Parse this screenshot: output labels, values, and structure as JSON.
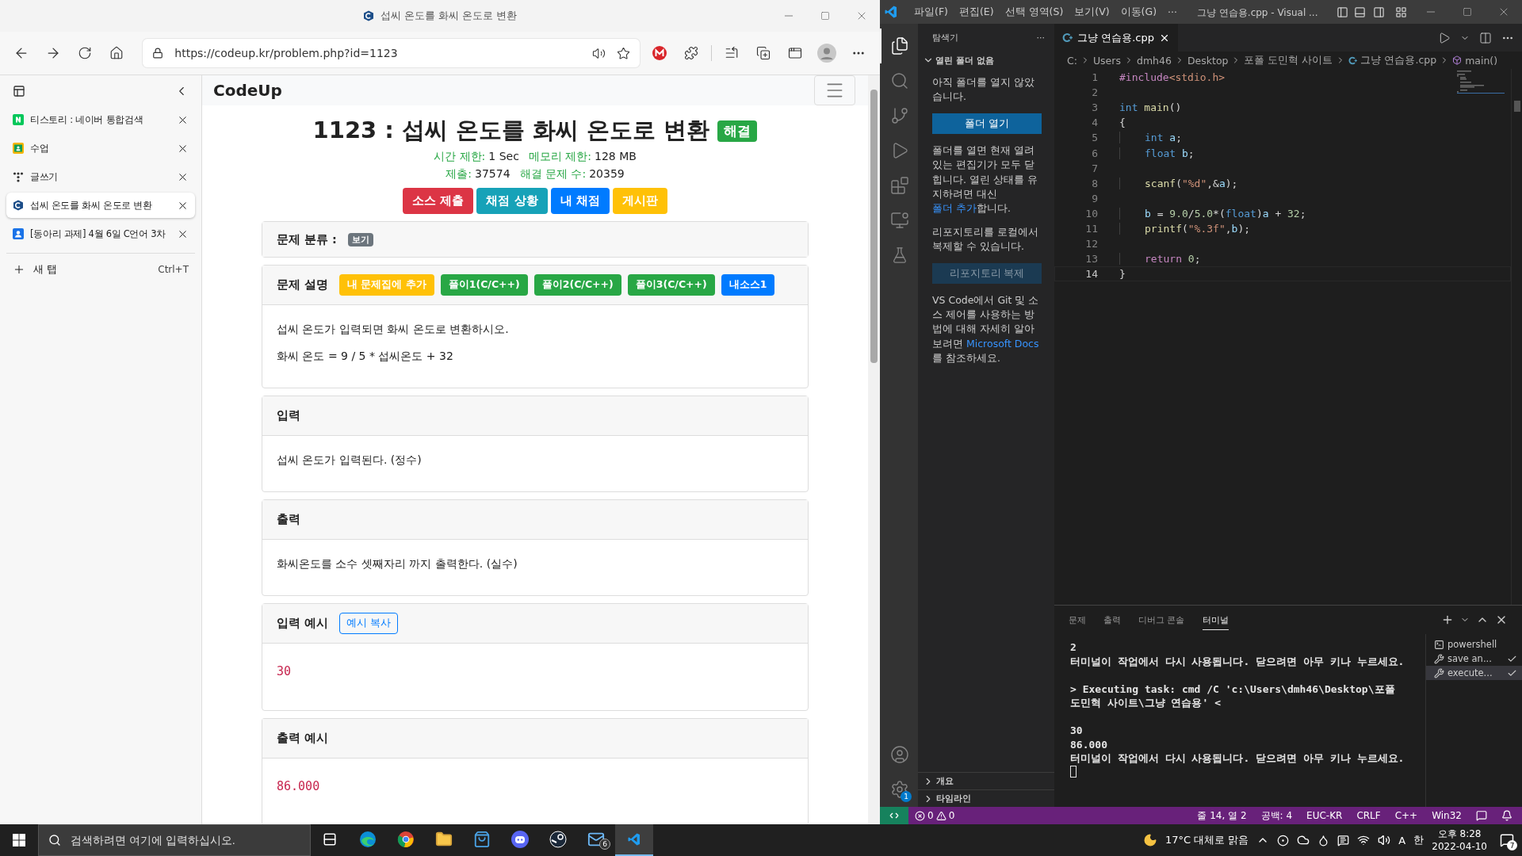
{
  "browser": {
    "title": "섭씨 온도를 화씨 온도로 변환",
    "url": "https://codeup.kr/problem.php?id=1123",
    "tabs": [
      {
        "label": "티스토리 : 네이버 통합검색",
        "selected": false
      },
      {
        "label": "수업",
        "selected": false
      },
      {
        "label": "글쓰기",
        "selected": false
      },
      {
        "label": "섭씨 온도를 화씨 온도로 변환",
        "selected": true
      },
      {
        "label": "[동아리 과제] 4월 6일 C언어 3차",
        "selected": false
      }
    ],
    "new_tab": {
      "label": "새 탭",
      "shortcut": "Ctrl+T"
    }
  },
  "page": {
    "brand": "CodeUp",
    "title": "1123 : 섭씨 온도를 화씨 온도로 변환",
    "solved_badge": "해결",
    "meta": [
      [
        {
          "label": "시간 제한:",
          "value": "1 Sec"
        },
        {
          "label": "메모리 제한:",
          "value": "128 MB"
        }
      ],
      [
        {
          "label": "제출:",
          "value": "37574"
        },
        {
          "label": "해결 문제 수:",
          "value": "20359"
        }
      ]
    ],
    "actions": [
      {
        "label": "소스 제출",
        "color": "#dc3545"
      },
      {
        "label": "채점 상황",
        "color": "#17a2b8"
      },
      {
        "label": "내 채점",
        "color": "#007bff"
      },
      {
        "label": "게시판",
        "color": "#ffc107"
      }
    ],
    "cards": [
      {
        "kind": "category",
        "title": "문제 분류 :",
        "badge": "보기"
      },
      {
        "kind": "text",
        "title": "문제 설명",
        "buttons": [
          {
            "label": "내 문제집에 추가",
            "color": "#ffc107"
          },
          {
            "label": "풀이1(C/C++)",
            "color": "#28a745"
          },
          {
            "label": "풀이2(C/C++)",
            "color": "#28a745"
          },
          {
            "label": "풀이3(C/C++)",
            "color": "#28a745"
          },
          {
            "label": "내소스1",
            "color": "#007bff"
          }
        ],
        "paragraphs": [
          "섭씨 온도가 입력되면 화씨 온도로 변환하시오.",
          "화씨 온도 = 9 / 5 * 섭씨온도 + 32"
        ]
      },
      {
        "kind": "text",
        "title": "입력",
        "paragraphs": [
          "섭씨 온도가 입력된다. (정수)"
        ]
      },
      {
        "kind": "text",
        "title": "출력",
        "paragraphs": [
          "화씨온도를 소수 셋째자리 까지 출력한다. (실수)"
        ]
      },
      {
        "kind": "sample",
        "title": "입력 예시",
        "copy_button": "예시 복사",
        "sample": "30"
      },
      {
        "kind": "sample",
        "title": "출력 예시",
        "sample": "86.000"
      }
    ]
  },
  "vscode": {
    "menu": [
      "파일(F)",
      "편집(E)",
      "선택 영역(S)",
      "보기(V)",
      "이동(G)",
      "···"
    ],
    "title": "그냥 연습용.cpp - Visual ...",
    "explorer": {
      "header": "탐색기",
      "more": "···",
      "section": "열린 폴더 없음",
      "intro": "아직 폴더를 열지 않았습니다.",
      "open_button": "폴더 열기",
      "note": {
        "before": "폴더를 열면 현재 열려 있는 편집기가 모두 닫힙니다. 열린 상태를 유지하려면 대신 ",
        "link": "폴더 추가",
        "after": "합니다."
      },
      "clone_text": "리포지토리를 로컬에서 복제할 수 있습니다.",
      "clone_button": "리포지토리 복제",
      "git_note": {
        "before": "VS Code에서 Git 및 소스 제어를 사용하는 방법에 대해 자세히 알아보려면 ",
        "link": "Microsoft Docs",
        "after": "를 참조하세요."
      },
      "bottom_sections": [
        "개요",
        "타임라인"
      ]
    },
    "settings_badge": "1",
    "tab": {
      "label": "그냥 연습용.cpp"
    },
    "breadcrumb": [
      "C:",
      "Users",
      "dmh46",
      "Desktop",
      "포폴 도민혁 사이트",
      "그냥 연습용.cpp",
      "main()"
    ],
    "code": [
      {
        "number": "1",
        "current": false,
        "indented": false,
        "tokens": [
          {
            "text": "#include",
            "kind": "control"
          },
          {
            "text": "<stdio.h>",
            "kind": "string"
          }
        ]
      },
      {
        "number": "2",
        "current": false
      },
      {
        "number": "3",
        "current": false,
        "indented": false,
        "tokens": [
          {
            "text": "int ",
            "kind": "keyword"
          },
          {
            "text": "main",
            "kind": "function"
          },
          {
            "text": "()",
            "kind": "plain"
          }
        ]
      },
      {
        "number": "4",
        "current": false,
        "indented": false,
        "tokens": [
          {
            "text": "{",
            "kind": "plain"
          }
        ]
      },
      {
        "number": "5",
        "current": false,
        "indented": true,
        "tokens": [
          {
            "text": "int ",
            "kind": "keyword"
          },
          {
            "text": "a",
            "kind": "variable"
          },
          {
            "text": ";",
            "kind": "plain"
          }
        ]
      },
      {
        "number": "6",
        "current": false,
        "indented": true,
        "tokens": [
          {
            "text": "float ",
            "kind": "keyword"
          },
          {
            "text": "b",
            "kind": "variable"
          },
          {
            "text": ";",
            "kind": "plain"
          }
        ]
      },
      {
        "number": "7",
        "current": false
      },
      {
        "number": "8",
        "current": false,
        "indented": true,
        "tokens": [
          {
            "text": "scanf",
            "kind": "function"
          },
          {
            "text": "(",
            "kind": "plain"
          },
          {
            "text": "\"%d\"",
            "kind": "string"
          },
          {
            "text": ",&",
            "kind": "plain"
          },
          {
            "text": "a",
            "kind": "variable"
          },
          {
            "text": ");",
            "kind": "plain"
          }
        ]
      },
      {
        "number": "9",
        "current": false
      },
      {
        "number": "10",
        "current": false,
        "indented": true,
        "tokens": [
          {
            "text": "b",
            "kind": "variable"
          },
          {
            "text": " = ",
            "kind": "plain"
          },
          {
            "text": "9.0",
            "kind": "number"
          },
          {
            "text": "/",
            "kind": "plain"
          },
          {
            "text": "5.0",
            "kind": "number"
          },
          {
            "text": "*(",
            "kind": "plain"
          },
          {
            "text": "float",
            "kind": "keyword"
          },
          {
            "text": ")",
            "kind": "plain"
          },
          {
            "text": "a",
            "kind": "variable"
          },
          {
            "text": " + ",
            "kind": "plain"
          },
          {
            "text": "32",
            "kind": "number"
          },
          {
            "text": ";",
            "kind": "plain"
          }
        ]
      },
      {
        "number": "11",
        "current": false,
        "indented": true,
        "tokens": [
          {
            "text": "printf",
            "kind": "function"
          },
          {
            "text": "(",
            "kind": "plain"
          },
          {
            "text": "\"%.3f\"",
            "kind": "string"
          },
          {
            "text": ",",
            "kind": "plain"
          },
          {
            "text": "b",
            "kind": "variable"
          },
          {
            "text": ");",
            "kind": "plain"
          }
        ]
      },
      {
        "number": "12",
        "current": false
      },
      {
        "number": "13",
        "current": false,
        "indented": true,
        "tokens": [
          {
            "text": "return ",
            "kind": "control"
          },
          {
            "text": "0",
            "kind": "number"
          },
          {
            "text": ";",
            "kind": "plain"
          }
        ]
      },
      {
        "number": "14",
        "current": true,
        "indented": false,
        "tokens": [
          {
            "text": "}",
            "kind": "plain"
          }
        ]
      }
    ],
    "panel_tabs": [
      {
        "label": "문제",
        "selected": false
      },
      {
        "label": "출력",
        "selected": false
      },
      {
        "label": "디버그 콘솔",
        "selected": false
      },
      {
        "label": "터미널",
        "selected": true
      }
    ],
    "terminal": [
      [
        "2",
        "터미널이 작업에서 다시 사용됩니다. 닫으려면 아무 키나 누르세요."
      ],
      [
        "> Executing task: cmd /C 'c:\\Users\\dmh46\\Desktop\\포폴 도민혁 사이트\\그냥 연습용' <"
      ],
      [
        "30",
        "86.000",
        "터미널이 작업에서 다시 사용됩니다. 닫으려면 아무 키나 누르세요."
      ]
    ],
    "terminals": [
      {
        "label": "powershell",
        "kind": "shell",
        "selected": false
      },
      {
        "label": "save an...",
        "kind": "task",
        "selected": false
      },
      {
        "label": "execute...",
        "kind": "task",
        "selected": true
      }
    ],
    "status": {
      "errors": "0",
      "warnings": "0",
      "right": [
        "줄 14, 열 2",
        "공백: 4",
        "EUC-KR",
        "CRLF",
        "C++",
        "Win32"
      ]
    }
  },
  "taskbar": {
    "search_placeholder": "검색하려면 여기에 입력하십시오.",
    "mail_badge": "6",
    "weather": "17°C 대체로 맑음",
    "ime": [
      "A",
      "한"
    ],
    "time": "오후 8:28",
    "date": "2022-04-10",
    "notifications": "7"
  }
}
